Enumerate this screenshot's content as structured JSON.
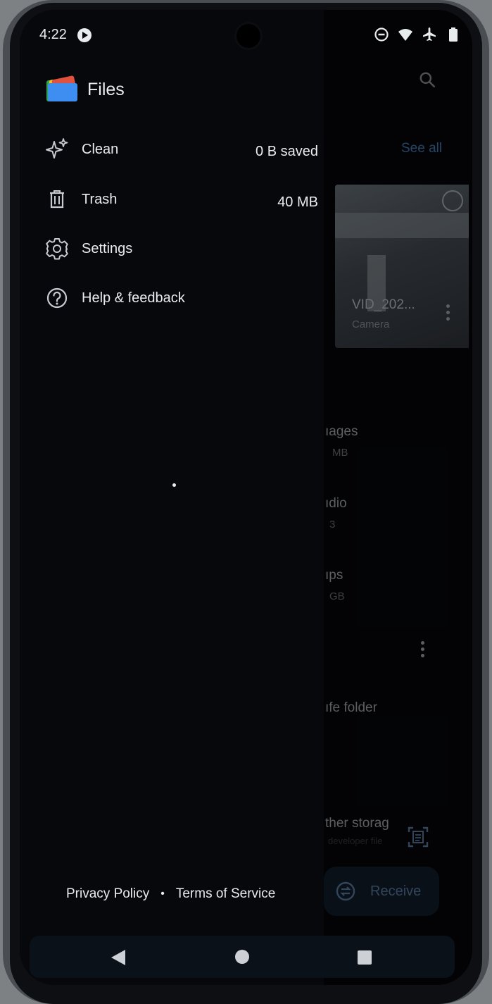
{
  "status_bar": {
    "time": "4:22",
    "icons": [
      "media-badge-icon",
      "do-not-disturb-icon",
      "wifi-icon",
      "airplane-icon",
      "battery-icon"
    ]
  },
  "drawer": {
    "app_title": "Files",
    "items": [
      {
        "icon": "sparkle-icon",
        "label": "Clean",
        "value": "0 B saved"
      },
      {
        "icon": "trash-icon",
        "label": "Trash",
        "value": "40 MB"
      },
      {
        "icon": "gear-icon",
        "label": "Settings"
      },
      {
        "icon": "help-icon",
        "label": "Help & feedback"
      }
    ],
    "footer": {
      "privacy": "Privacy Policy",
      "separator": "•",
      "terms": "Terms of Service"
    }
  },
  "background": {
    "see_all": "See all",
    "recent_file_name": "VID_202...",
    "recent_file_source": "Camera",
    "categories": [
      {
        "label": "ıages",
        "size": "MB"
      },
      {
        "label": "ıdio",
        "size": "3"
      },
      {
        "label": "ıps",
        "size": "GB"
      }
    ],
    "safe_folder": "ıfe folder",
    "other_storage": "ther storag",
    "other_storage_sub": "developer file",
    "receive": "Receive"
  },
  "colors": {
    "drawer_bg": "#07080b",
    "text": "#e9ecef",
    "accent": "#3a6a9e"
  }
}
